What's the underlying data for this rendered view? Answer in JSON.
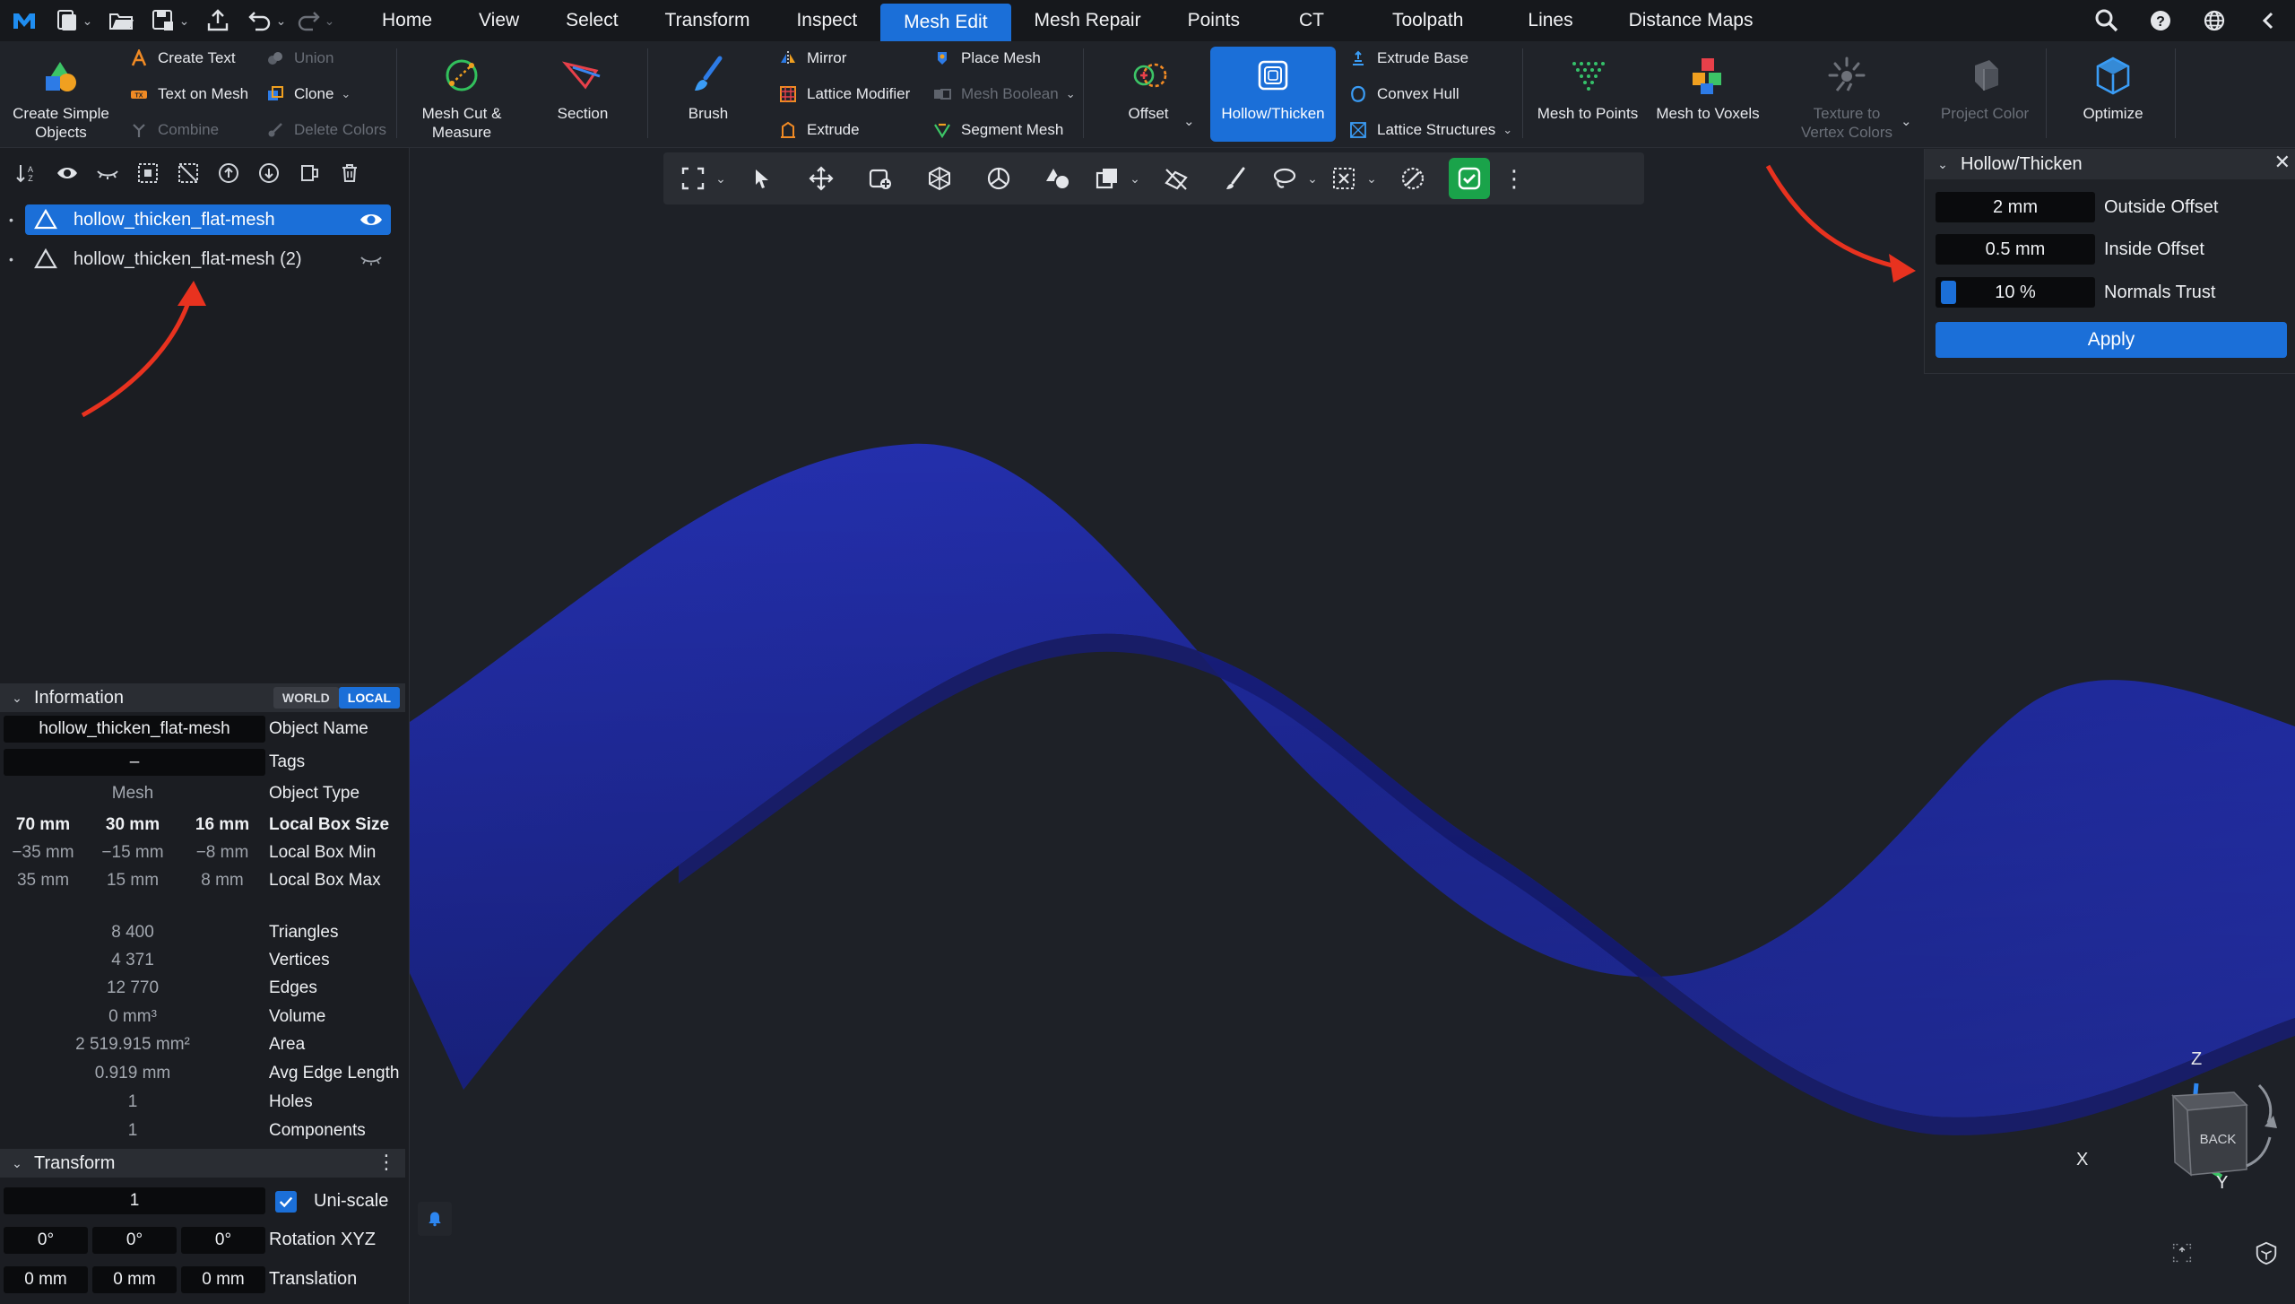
{
  "menubar": {
    "tabs": [
      "Home",
      "View",
      "Select",
      "Transform",
      "Inspect",
      "Mesh Edit",
      "Mesh Repair",
      "Points",
      "CT",
      "Toolpath",
      "Lines",
      "Distance Maps"
    ],
    "active_tab": "Mesh Edit",
    "accent": "#1b6fd8"
  },
  "ribbon": {
    "create_simple_objects": "Create Simple Objects",
    "create_text": "Create Text",
    "text_on_mesh": "Text on Mesh",
    "combine": "Combine",
    "union": "Union",
    "clone": "Clone",
    "delete_colors": "Delete Colors",
    "mesh_cut_measure": "Mesh Cut & Measure",
    "section": "Section",
    "brush": "Brush",
    "mirror": "Mirror",
    "lattice_modifier": "Lattice Modifier",
    "extrude": "Extrude",
    "place_mesh": "Place Mesh",
    "mesh_boolean": "Mesh Boolean",
    "segment_mesh": "Segment Mesh",
    "offset": "Offset",
    "hollow_thicken": "Hollow/Thicken",
    "extrude_base": "Extrude Base",
    "convex_hull": "Convex Hull",
    "lattice_structures": "Lattice Structures",
    "mesh_to_points": "Mesh to Points",
    "mesh_to_voxels": "Mesh to Voxels",
    "texture_to_vertex_colors": "Texture to Vertex Colors",
    "project_color": "Project Color",
    "optimize": "Optimize"
  },
  "scene": {
    "items": [
      {
        "name": "hollow_thicken_flat-mesh",
        "selected": true
      },
      {
        "name": "hollow_thicken_flat-mesh (2)",
        "selected": false
      }
    ]
  },
  "information": {
    "title": "Information",
    "world": "WORLD",
    "local": "LOCAL",
    "object_name_value": "hollow_thicken_flat-mesh",
    "object_name_label": "Object Name",
    "tags_value": "–",
    "tags_label": "Tags",
    "object_type_value": "Mesh",
    "object_type_label": "Object Type",
    "box_size": [
      "70 mm",
      "30 mm",
      "16 mm"
    ],
    "box_size_label": "Local Box Size",
    "box_min": [
      "−35 mm",
      "−15 mm",
      "−8 mm"
    ],
    "box_min_label": "Local Box Min",
    "box_max": [
      "35 mm",
      "15 mm",
      "8 mm"
    ],
    "box_max_label": "Local Box Max",
    "triangles_value": "8 400",
    "triangles_label": "Triangles",
    "vertices_value": "4 371",
    "vertices_label": "Vertices",
    "edges_value": "12 770",
    "edges_label": "Edges",
    "volume_value": "0 mm³",
    "volume_label": "Volume",
    "area_value": "2 519.915 mm²",
    "area_label": "Area",
    "avg_edge_value": "0.919 mm",
    "avg_edge_label": "Avg Edge Length",
    "holes_value": "1",
    "holes_label": "Holes",
    "components_value": "1",
    "components_label": "Components"
  },
  "transform": {
    "title": "Transform",
    "scale_value": "1",
    "uniscale_label": "Uni-scale",
    "rotation": [
      "0°",
      "0°",
      "0°"
    ],
    "rotation_label": "Rotation XYZ",
    "translation": [
      "0 mm",
      "0 mm",
      "0 mm"
    ],
    "translation_label": "Translation"
  },
  "hollow_thicken_panel": {
    "title": "Hollow/Thicken",
    "outside_offset_value": "2 mm",
    "outside_offset_label": "Outside Offset",
    "inside_offset_value": "0.5 mm",
    "inside_offset_label": "Inside Offset",
    "normals_trust_value": "10 %",
    "normals_trust_label": "Normals Trust",
    "normals_trust_fraction": 0.1,
    "apply": "Apply"
  },
  "navcube": {
    "face": "BACK",
    "z": "Z",
    "x": "X",
    "y": "Y"
  },
  "viewport": {
    "mesh_color": "#2a35b8",
    "annotation_arrow_color": "#e8321f"
  }
}
